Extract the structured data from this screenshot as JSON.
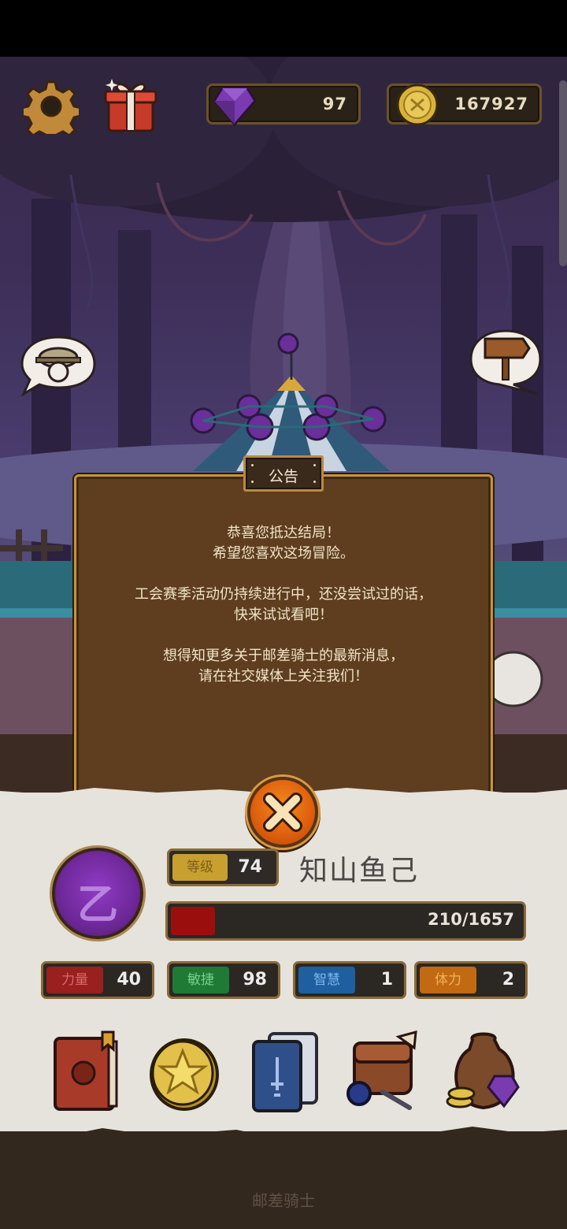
{
  "resources": {
    "gems": "97",
    "coins": "167927"
  },
  "dialog": {
    "title": "公告",
    "lines": [
      "恭喜您抵达结局！",
      "希望您喜欢这场冒险。",
      "工会赛季活动仍持续进行中，还没尝试过的话，",
      "快来试试看吧！",
      "想得知更多关于邮差骑士的最新消息，",
      "请在社交媒体上关注我们！"
    ]
  },
  "character": {
    "avatar_letter": "乙",
    "level_label": "等级",
    "level": "74",
    "name": "知山鱼己",
    "hp_text": "210/1657",
    "hp_current": 210,
    "hp_max": 1657,
    "stats": [
      {
        "label": "力量",
        "value": "40",
        "color": "#9a1f1f",
        "text_color": "#d86a6a"
      },
      {
        "label": "敏捷",
        "value": "98",
        "color": "#1f7a36",
        "text_color": "#7ad08a"
      },
      {
        "label": "智慧",
        "value": "1",
        "color": "#1f5fa0",
        "text_color": "#7fb6ec"
      },
      {
        "label": "体力",
        "value": "2",
        "color": "#c26a12",
        "text_color": "#f0b062"
      }
    ]
  },
  "menu_icons": [
    "book-icon",
    "coin-icon",
    "cards-icon",
    "inventory-bag-icon",
    "loot-sack-icon"
  ],
  "footer": {
    "title": "邮差骑士"
  },
  "colors": {
    "wood": "#5e3e1f",
    "gold_border": "#c8943a",
    "close_button": "#e0620f",
    "hp_fill": "#9b0e0e"
  }
}
